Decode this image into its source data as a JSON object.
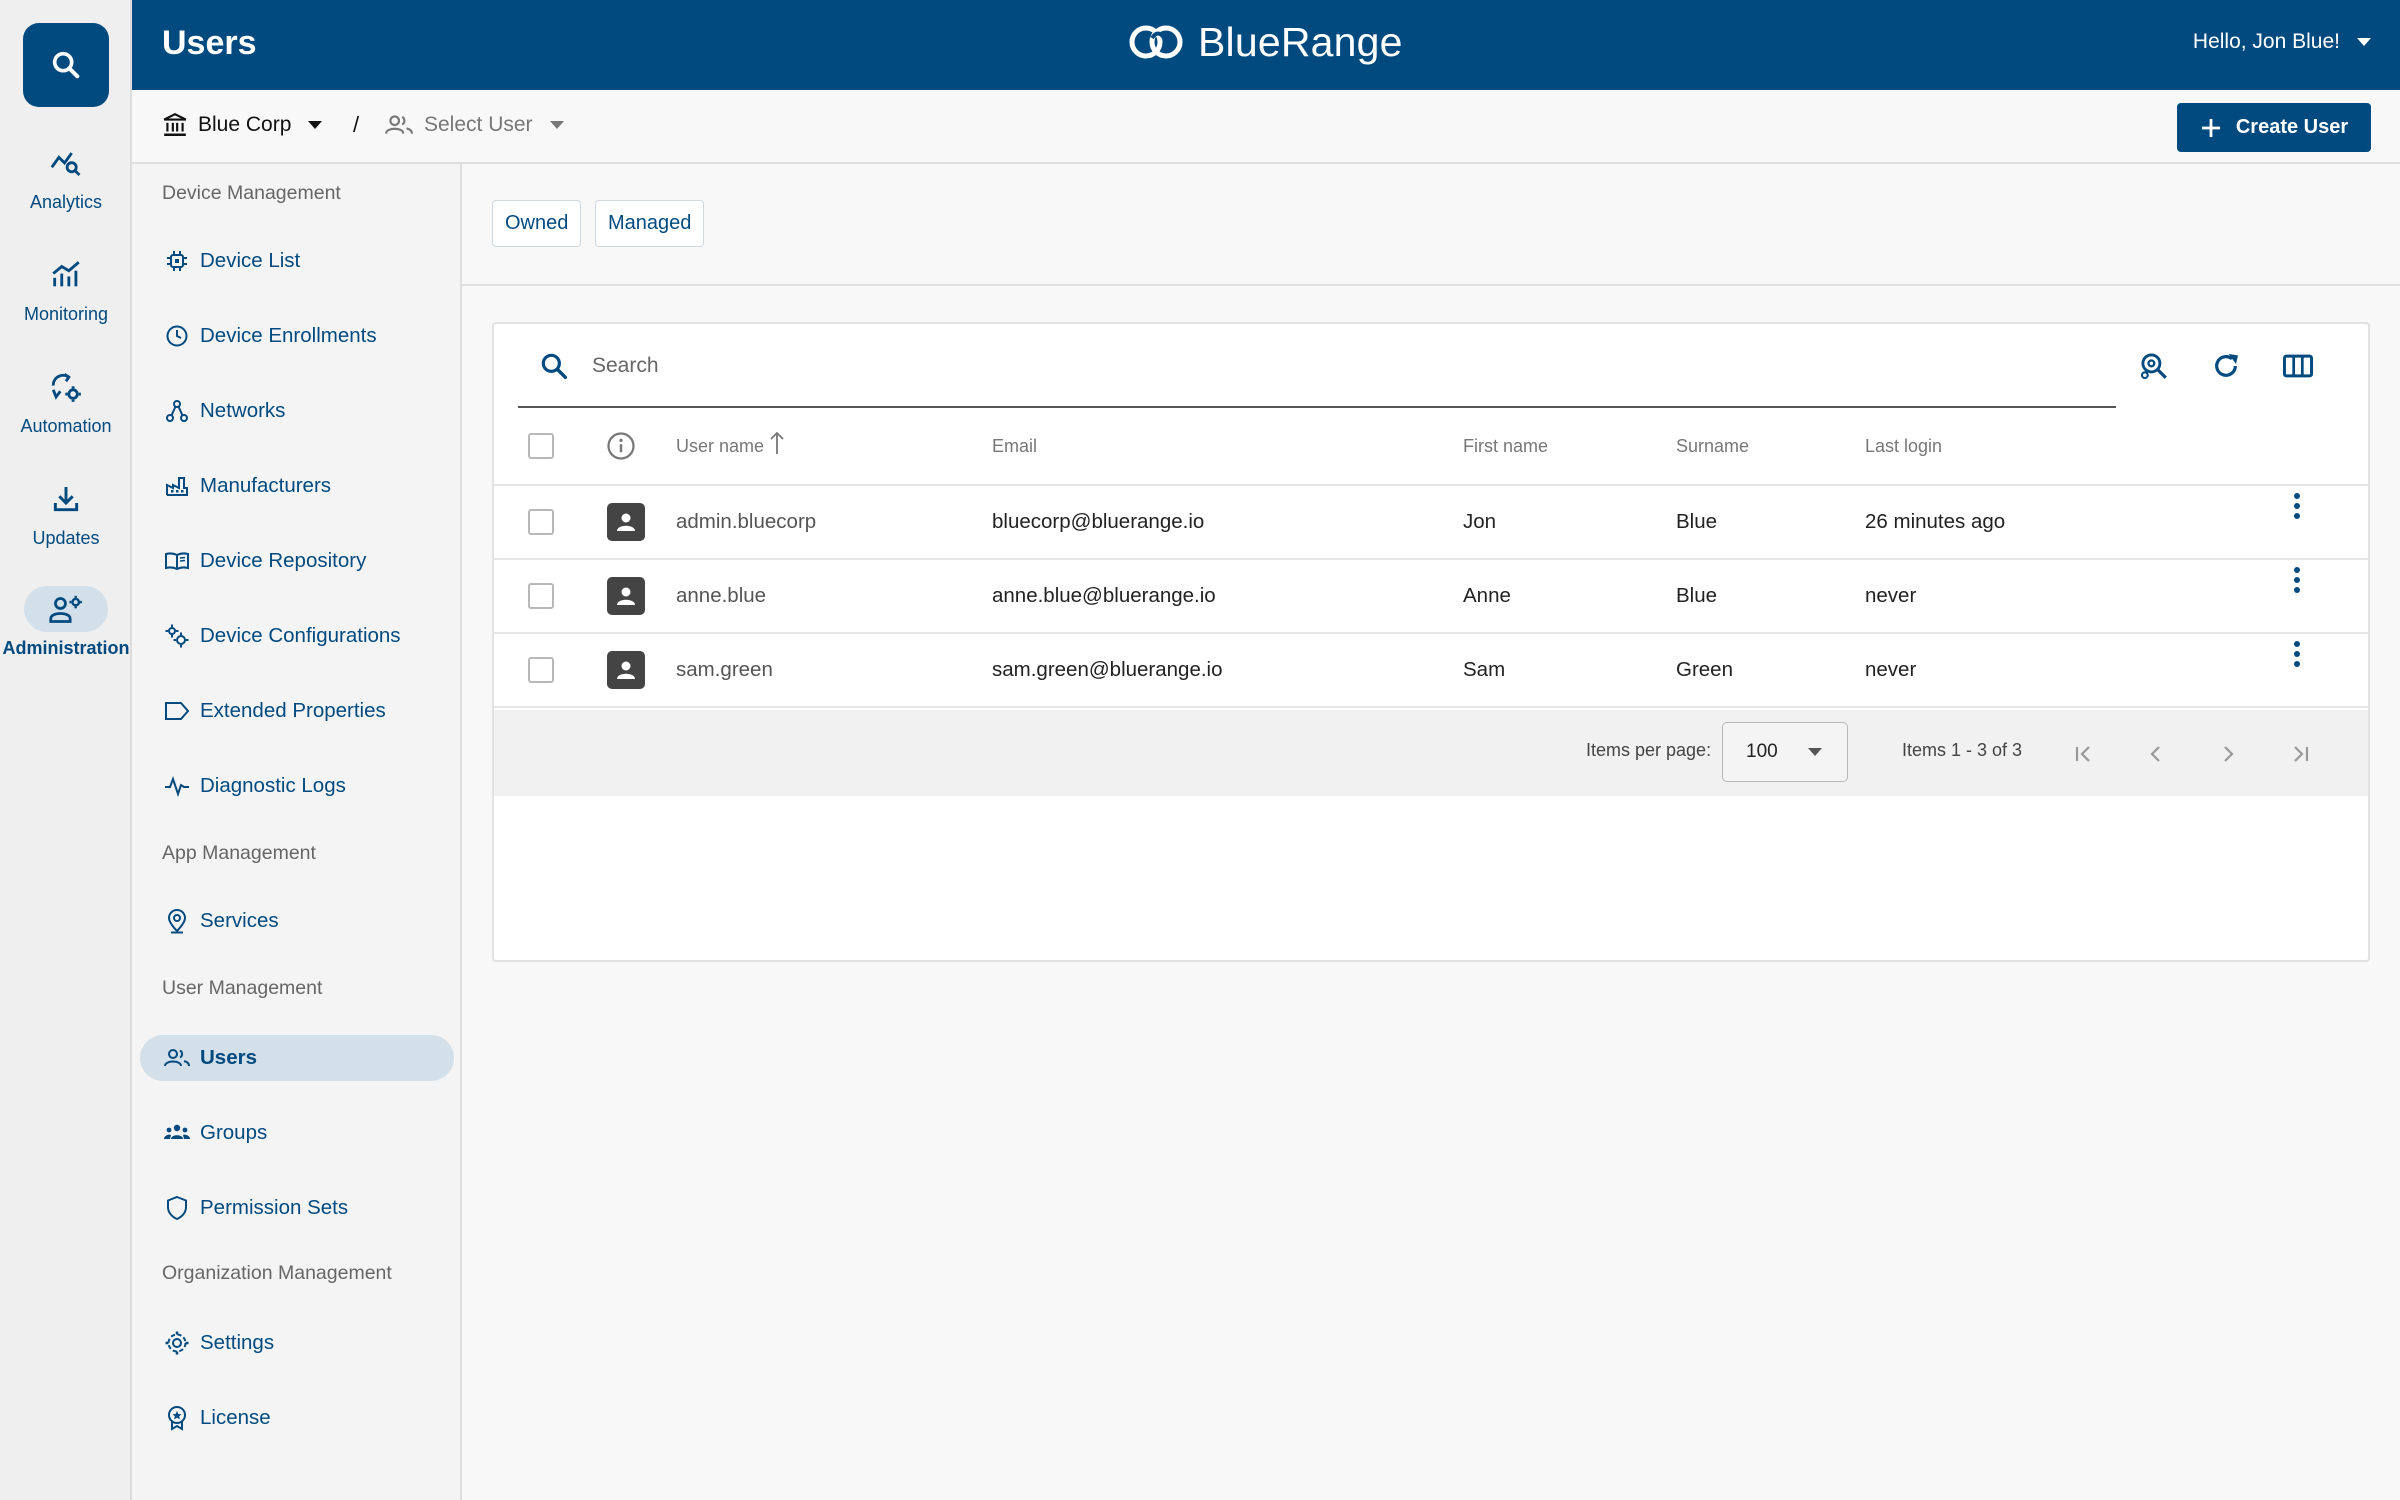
{
  "header": {
    "page_title": "Users",
    "logo_text": "BlueRange",
    "user_greeting": "Hello, Jon Blue!"
  },
  "rail": {
    "items": [
      {
        "label": "Analytics",
        "icon": "analytics-icon"
      },
      {
        "label": "Monitoring",
        "icon": "monitoring-icon"
      },
      {
        "label": "Automation",
        "icon": "automation-icon"
      },
      {
        "label": "Updates",
        "icon": "download-icon"
      },
      {
        "label": "Administration",
        "icon": "admin-icon",
        "active": true
      }
    ]
  },
  "toolbar": {
    "organization": "Blue Corp",
    "separator": "/",
    "user_select": "Select User",
    "create_label": "Create User"
  },
  "sidebar": {
    "sections": [
      {
        "title": "Device Management",
        "items": [
          "Device List",
          "Device Enrollments",
          "Networks",
          "Manufacturers",
          "Device Repository",
          "Device Configurations",
          "Extended Properties",
          "Diagnostic Logs"
        ]
      },
      {
        "title": "App Management",
        "items": [
          "Services"
        ]
      },
      {
        "title": "User Management",
        "items": [
          "Users",
          "Groups",
          "Permission Sets"
        ]
      },
      {
        "title": "Organization Management",
        "items": [
          "Settings",
          "License"
        ]
      }
    ],
    "labels": {
      "device_management": "Device Management",
      "device_list": "Device List",
      "device_enrollments": "Device Enrollments",
      "networks": "Networks",
      "manufacturers": "Manufacturers",
      "device_repository": "Device Repository",
      "device_configurations": "Device Configurations",
      "extended_properties": "Extended Properties",
      "diagnostic_logs": "Diagnostic Logs",
      "app_management": "App Management",
      "services": "Services",
      "user_management": "User Management",
      "users": "Users",
      "groups": "Groups",
      "permission_sets": "Permission Sets",
      "organization_management": "Organization Management",
      "settings": "Settings",
      "license": "License"
    },
    "active_item": "Users"
  },
  "filters": {
    "owned": "Owned",
    "managed": "Managed"
  },
  "search": {
    "placeholder": "Search",
    "value": ""
  },
  "table": {
    "columns": {
      "username": "User name",
      "email": "Email",
      "first_name": "First name",
      "surname": "Surname",
      "last_login": "Last login"
    },
    "sort_column": "User name",
    "sort_direction": "ascending",
    "rows": [
      {
        "username": "admin.bluecorp",
        "email": "bluecorp@bluerange.io",
        "first_name": "Jon",
        "surname": "Blue",
        "last_login": "26 minutes ago"
      },
      {
        "username": "anne.blue",
        "email": "anne.blue@bluerange.io",
        "first_name": "Anne",
        "surname": "Blue",
        "last_login": "never"
      },
      {
        "username": "sam.green",
        "email": "sam.green@bluerange.io",
        "first_name": "Sam",
        "surname": "Green",
        "last_login": "never"
      }
    ]
  },
  "pager": {
    "items_per_page_label": "Items per page:",
    "items_per_page": "100",
    "range_label": "Items 1 - 3 of 3"
  },
  "colors": {
    "brand": "#004a80",
    "active_bg": "#d3dfe9"
  }
}
